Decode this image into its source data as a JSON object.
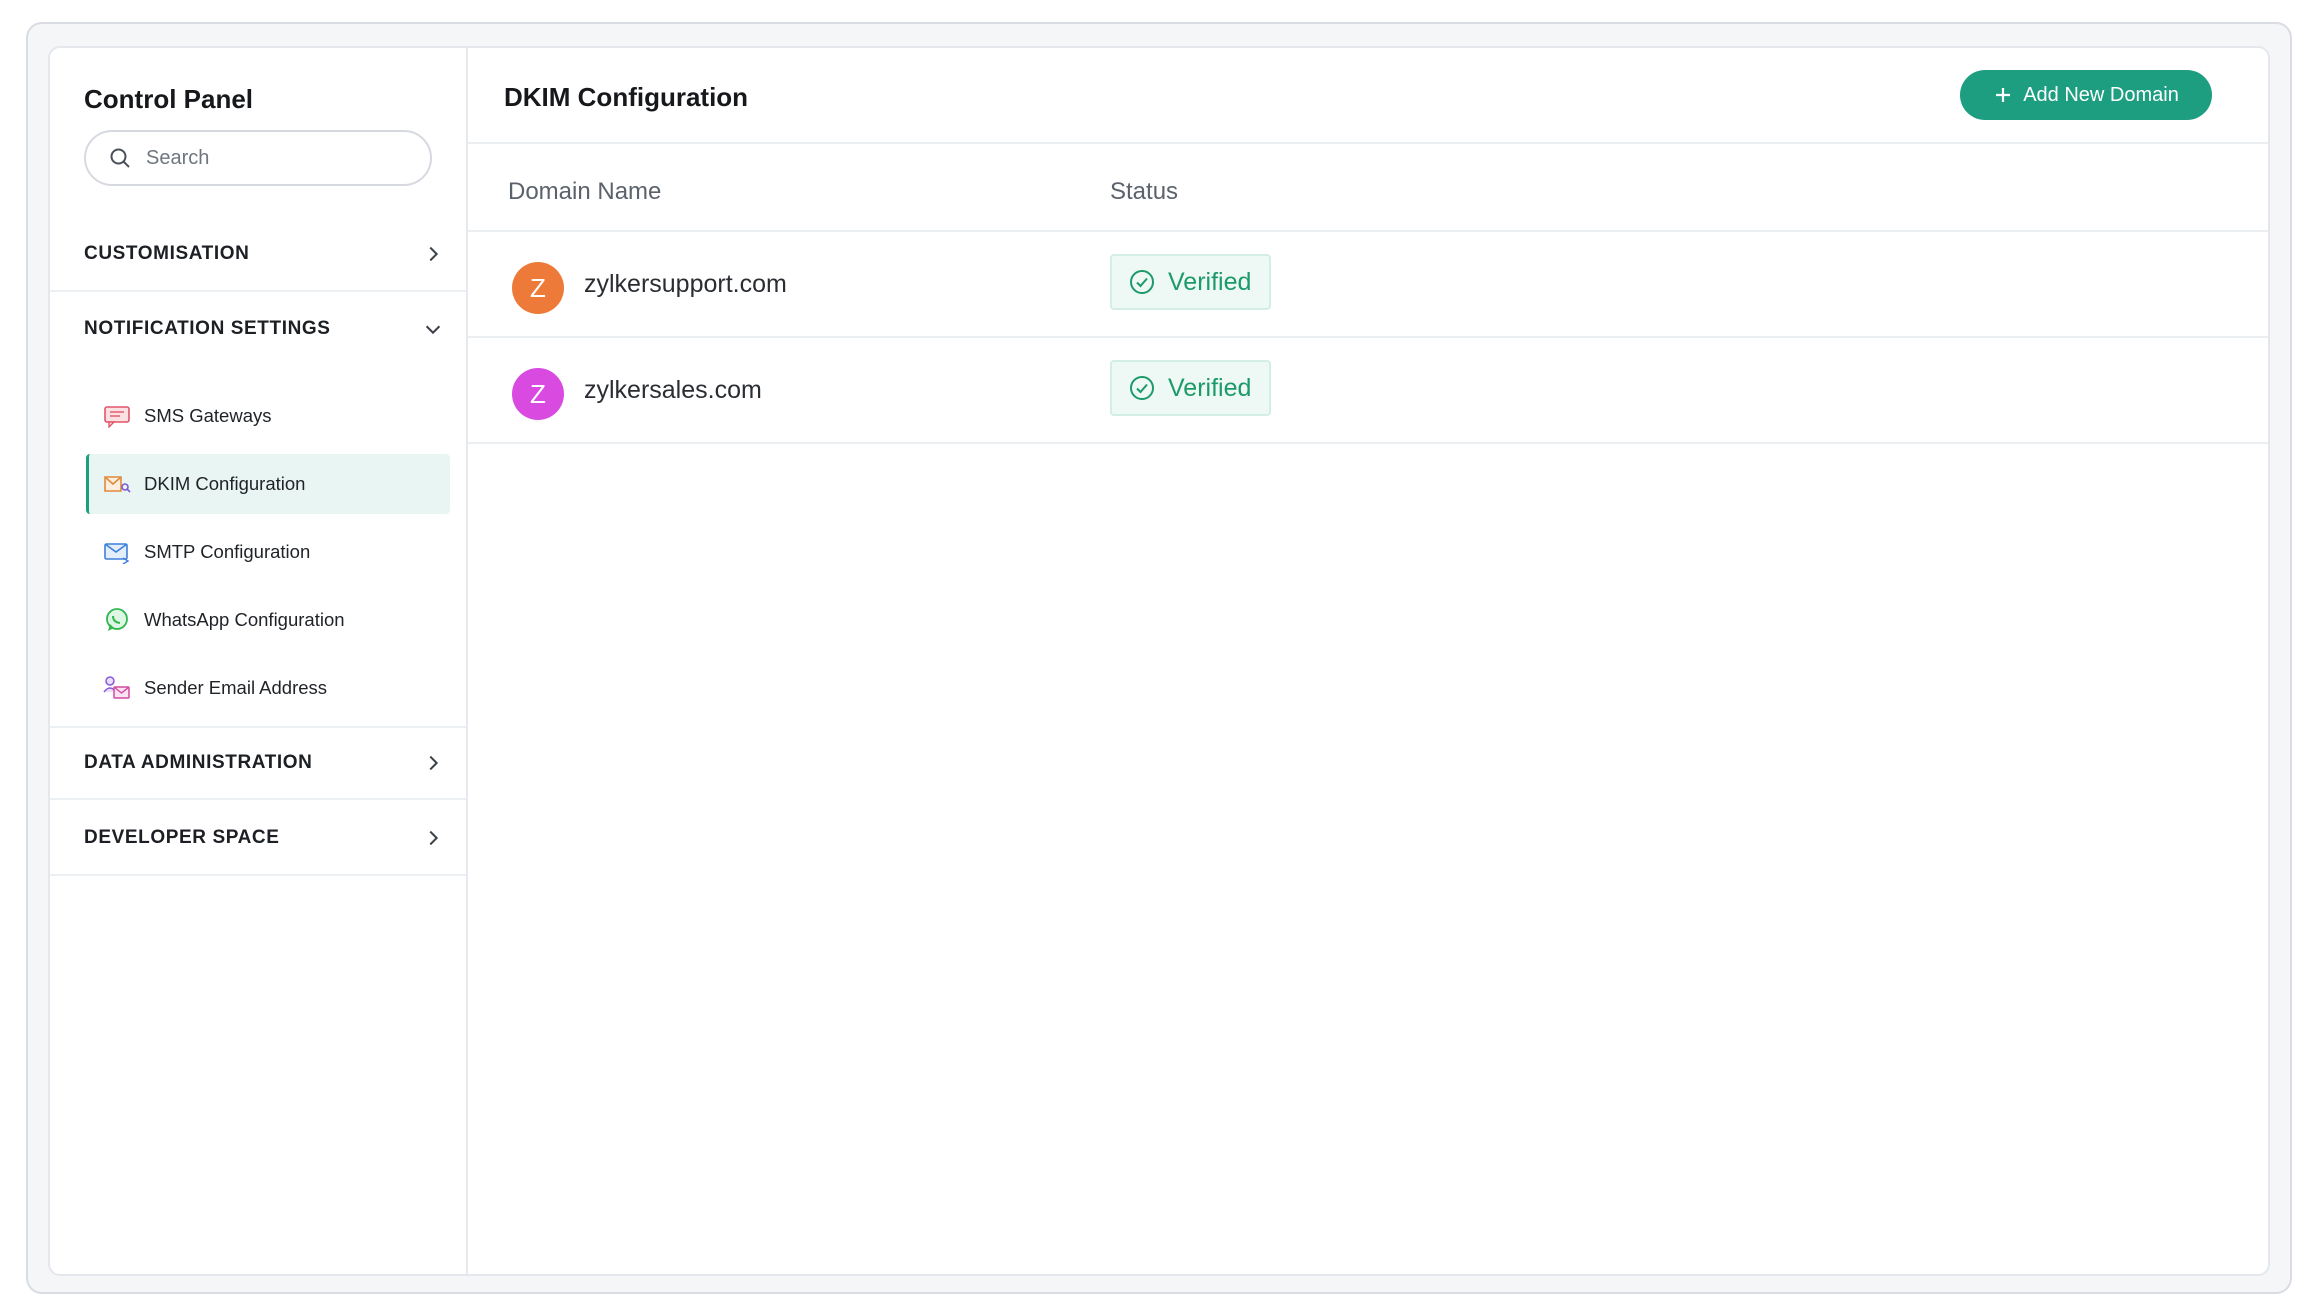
{
  "sidebar": {
    "title": "Control Panel",
    "search_placeholder": "Search",
    "sections": {
      "customisation": "CUSTOMISATION",
      "notification_settings": "NOTIFICATION SETTINGS",
      "data_administration": "DATA ADMINISTRATION",
      "developer_space": "DEVELOPER SPACE"
    },
    "notification_items": [
      {
        "label": "SMS Gateways",
        "icon": "sms-icon"
      },
      {
        "label": "DKIM Configuration",
        "icon": "dkim-icon",
        "active": true
      },
      {
        "label": "SMTP Configuration",
        "icon": "smtp-icon"
      },
      {
        "label": "WhatsApp Configuration",
        "icon": "whatsapp-icon"
      },
      {
        "label": "Sender Email Address",
        "icon": "sender-email-icon"
      }
    ]
  },
  "main": {
    "title": "DKIM Configuration",
    "add_button_label": "Add New Domain",
    "columns": {
      "domain": "Domain Name",
      "status": "Status"
    },
    "rows": [
      {
        "initial": "Z",
        "domain": "zylkersupport.com",
        "status": "Verified",
        "avatar_color": "#ee7a3a"
      },
      {
        "initial": "Z",
        "domain": "zylkersales.com",
        "status": "Verified",
        "avatar_color": "#d94be0"
      }
    ]
  },
  "colors": {
    "accent": "#1e9e80",
    "verified_text": "#1d9a6a",
    "verified_bg": "#eef9f5",
    "active_item_bg": "#e9f5f2"
  }
}
